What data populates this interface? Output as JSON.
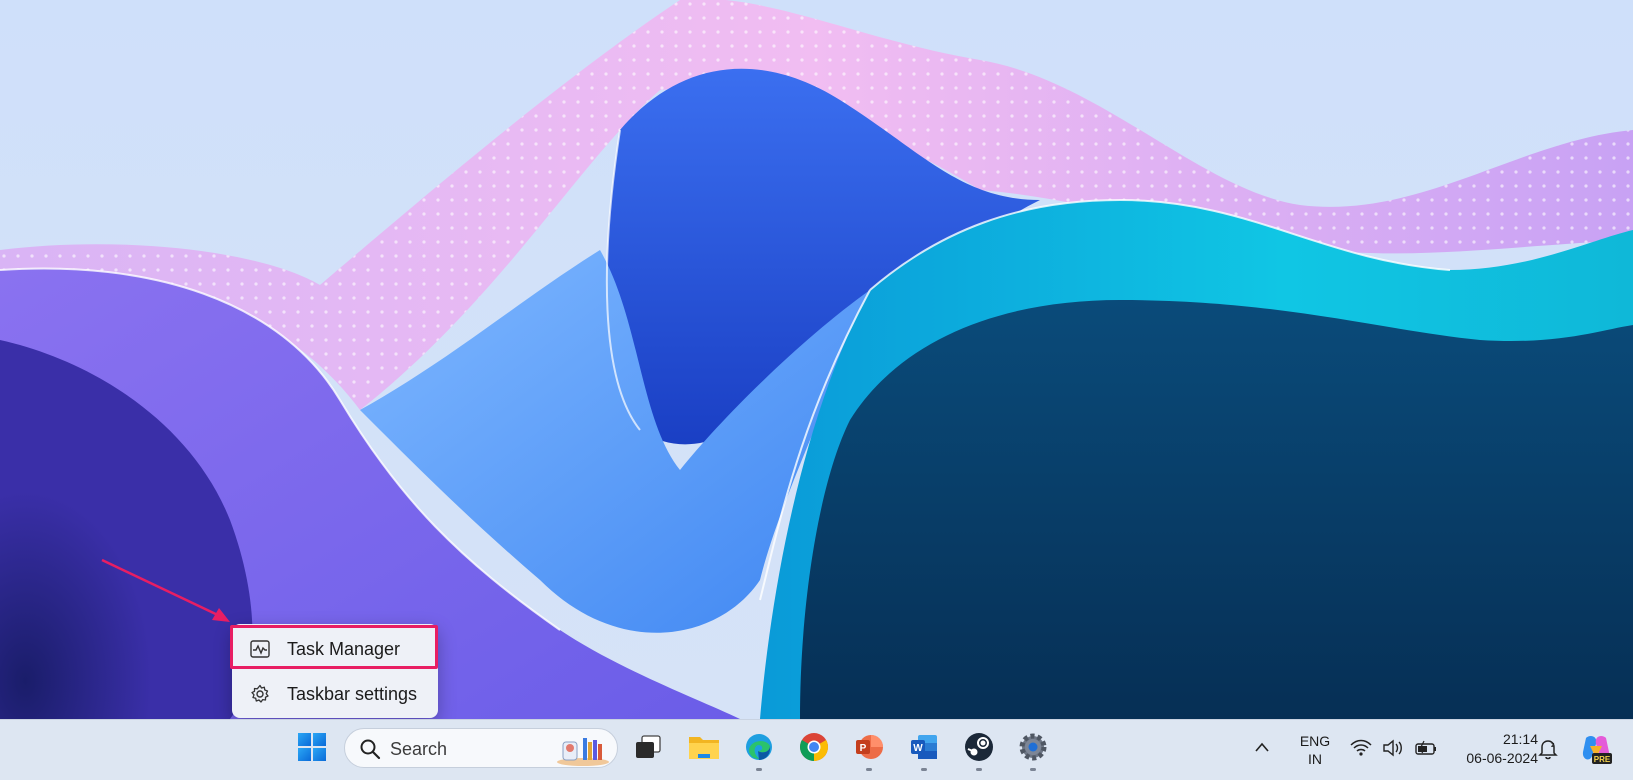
{
  "context_menu": {
    "items": [
      {
        "label": "Task Manager",
        "icon": "task-manager-icon"
      },
      {
        "label": "Taskbar settings",
        "icon": "gear-icon"
      }
    ],
    "highlight_color": "#e81e63"
  },
  "taskbar": {
    "search": {
      "placeholder": "Search"
    },
    "apps": [
      {
        "name": "Start",
        "icon": "windows-logo-icon"
      },
      {
        "name": "Task View",
        "icon": "task-view-icon"
      },
      {
        "name": "File Explorer",
        "icon": "folder-icon"
      },
      {
        "name": "Microsoft Edge",
        "icon": "edge-icon"
      },
      {
        "name": "Google Chrome",
        "icon": "chrome-icon"
      },
      {
        "name": "PowerPoint",
        "icon": "powerpoint-icon"
      },
      {
        "name": "Word",
        "icon": "word-icon"
      },
      {
        "name": "Steam",
        "icon": "steam-icon"
      },
      {
        "name": "Settings",
        "icon": "settings-app-icon"
      }
    ],
    "tray": {
      "language_line1": "ENG",
      "language_line2": "IN",
      "time": "21:14",
      "date": "06-06-2024",
      "copilot_badge": "PRE"
    }
  },
  "colors": {
    "taskbar_bg": "#dde6f2",
    "accent": "#0067c0",
    "annotation": "#e81e63"
  }
}
